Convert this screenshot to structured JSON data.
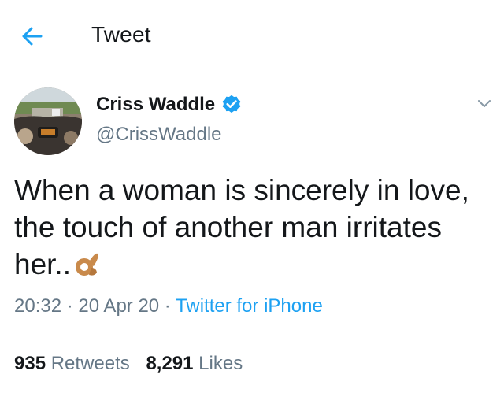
{
  "header": {
    "title": "Tweet",
    "back_icon": "arrow-left-icon",
    "accent_color": "#1da1f2"
  },
  "tweet": {
    "display_name": "Criss Waddle",
    "handle": "@CrissWaddle",
    "verified_icon": "verified-badge-icon",
    "more_icon": "chevron-down-icon",
    "text_line1": "When a woman is sincerely in love,",
    "text_line2": "the touch of another man irritates",
    "text_line3": "her..",
    "emoji_icon": "ok-hand-emoji-icon",
    "time": "20:32",
    "date": "20 Apr 20",
    "source": "Twitter for iPhone",
    "separator": " · "
  },
  "stats": {
    "retweets_count": "935",
    "retweets_label": "Retweets",
    "likes_count": "8,291",
    "likes_label": "Likes"
  },
  "colors": {
    "text": "#14171a",
    "secondary": "#657786",
    "link": "#1da1f2",
    "divider": "#e6ecf0"
  }
}
